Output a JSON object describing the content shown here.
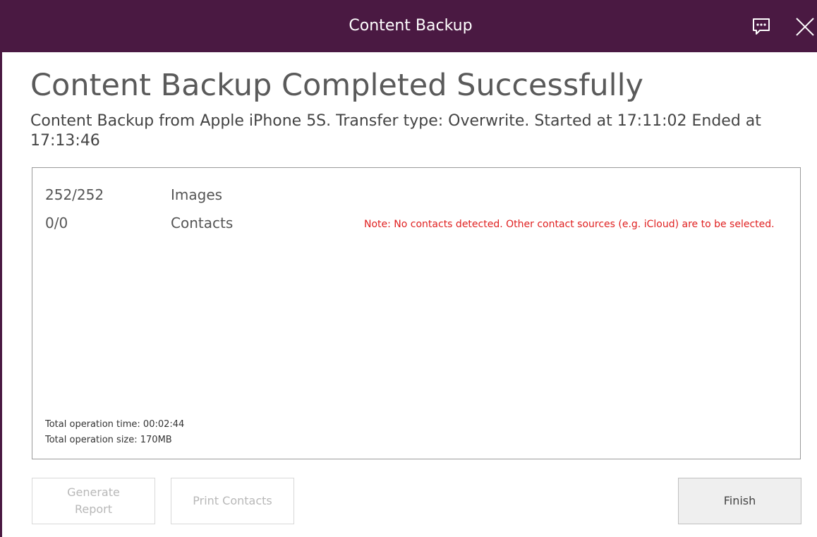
{
  "window": {
    "title": "Content Backup",
    "accent_color": "#4a1942",
    "chat_icon": "chat-bubble-icon",
    "close_icon": "close-icon"
  },
  "heading": "Content Backup Completed Successfully",
  "subtitle": "Content Backup from Apple iPhone 5S. Transfer type: Overwrite. Started at 17:11:02 Ended at 17:13:46",
  "results": [
    {
      "count": "252/252",
      "label": "Images"
    },
    {
      "count": "0/0",
      "label": "Contacts"
    }
  ],
  "note": "Note: No contacts detected. Other contact sources (e.g. iCloud) are to be selected.",
  "totals": {
    "time": "Total operation time: 00:02:44",
    "size": "Total operation size: 170MB"
  },
  "buttons": {
    "generate_report_line1": "Generate",
    "generate_report_line2": "Report",
    "print_contacts": "Print Contacts",
    "finish": "Finish"
  }
}
